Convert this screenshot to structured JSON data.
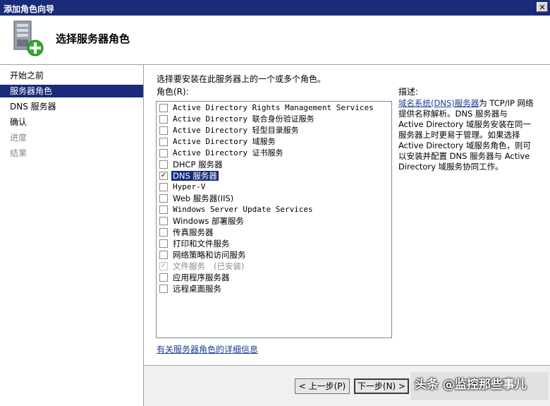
{
  "window": {
    "title": "添加角色向导",
    "close_glyph": "✕"
  },
  "header": {
    "title": "选择服务器角色",
    "icon": "server-add-icon"
  },
  "nav": {
    "items": [
      {
        "label": "开始之前",
        "state": "normal"
      },
      {
        "label": "服务器角色",
        "state": "active"
      },
      {
        "label": "DNS 服务器",
        "state": "normal"
      },
      {
        "label": "确认",
        "state": "normal"
      },
      {
        "label": "进度",
        "state": "disabled"
      },
      {
        "label": "结果",
        "state": "disabled"
      }
    ]
  },
  "main": {
    "instruction": "选择要安装在此服务器上的一个或多个角色。",
    "roles_label": "角色(R):",
    "roles": [
      {
        "label": "Active Directory Rights Management Services",
        "checked": false
      },
      {
        "label": "Active Directory 联合身份验证服务",
        "checked": false
      },
      {
        "label": "Active Directory 轻型目录服务",
        "checked": false
      },
      {
        "label": "Active Directory 域服务",
        "checked": false
      },
      {
        "label": "Active Directory 证书服务",
        "checked": false
      },
      {
        "label": "DHCP 服务器",
        "checked": false
      },
      {
        "label": "DNS 服务器",
        "checked": true,
        "selected": true
      },
      {
        "label": "Hyper-V",
        "checked": false
      },
      {
        "label": "Web 服务器(IIS)",
        "checked": false
      },
      {
        "label": "Windows Server Update Services",
        "checked": false
      },
      {
        "label": "Windows 部署服务",
        "checked": false
      },
      {
        "label": "传真服务器",
        "checked": false
      },
      {
        "label": "打印和文件服务",
        "checked": false
      },
      {
        "label": "网络策略和访问服务",
        "checked": false
      },
      {
        "label": "文件服务",
        "checked": true,
        "disabled": true,
        "status": "(已安装)"
      },
      {
        "label": "应用程序服务器",
        "checked": false
      },
      {
        "label": "远程桌面服务",
        "checked": false
      }
    ],
    "more_link": "有关服务器角色的详细信息",
    "description_label": "描述:",
    "description_link": "域名系统(DNS)服务器",
    "description_text": "为 TCP/IP 网络提供名称解析。DNS 服务器与 Active Directory 域服务安装在同一服务器上时更易于管理。如果选择 Active Directory 域服务角色，则可以安装并配置 DNS 服务器与 Active Directory 域服务协同工作。"
  },
  "footer": {
    "prev_label": "< 上一步(P)",
    "next_label": "下一步(N) >"
  },
  "watermark": "头条 @监控那些事儿"
}
